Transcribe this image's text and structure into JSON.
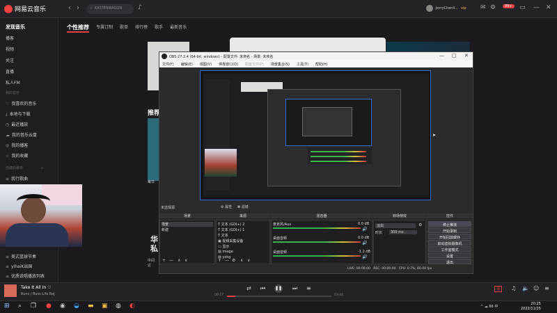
{
  "app": {
    "name": "网易云音乐"
  },
  "topbar": {
    "search_placeholder": "KASTENWAGON",
    "username": "JerryChenli...",
    "level": "vip",
    "badge": "99+"
  },
  "sidebar": {
    "items": [
      {
        "label": "发现音乐",
        "active": true
      },
      {
        "label": "播客"
      },
      {
        "label": "视频"
      },
      {
        "label": "关注"
      },
      {
        "label": "直播"
      },
      {
        "label": "私人FM"
      }
    ],
    "my_music_label": "我的音乐",
    "my_items": [
      "我喜欢的音乐",
      "本地与下载",
      "最近播放",
      "我的音乐云盘",
      "我的播客",
      "我的收藏"
    ],
    "created_label": "创建的歌单",
    "playlists": [
      "我行歌曲",
      "美式篮球节奏",
      "yihaiK出国",
      "优质说唱播放列表"
    ]
  },
  "tabs": [
    "个性推荐",
    "专属订制",
    "歌单",
    "排行榜",
    "歌手",
    "最新音乐"
  ],
  "main": {
    "recommend_title": "推荐",
    "daily_label": "每日",
    "big_text": "华\n私",
    "small_text": "中间\n达"
  },
  "obs": {
    "title": "OBS 27.2.4 (64-bit, windows) - 配置文件: 未命名 - 场景: 未命名",
    "menu": [
      "文件(F)",
      "编辑(E)",
      "视图(V)",
      "停靠窗口(D)",
      "配置文件(P)",
      "场景集合(S)",
      "工具(T)",
      "帮助(H)"
    ],
    "no_source": "未选择源",
    "prop_btn": "属性",
    "filter_btn": "滤镜",
    "docks": {
      "scenes": {
        "title": "场景",
        "items": [
          "场景",
          "新建"
        ]
      },
      "sources": {
        "title": "来源",
        "items": [
          "文本 (GDI+) 2",
          "文本 (GDI+) 1",
          "文本",
          "视频采集设备",
          "显示",
          "image",
          "yxkg"
        ]
      },
      "mixer": {
        "title": "混音器",
        "channels": [
          {
            "name": "麦克风/Aux",
            "db": "0.0 dB"
          },
          {
            "name": "桌面音频",
            "db": "0.0 dB"
          },
          {
            "name": "桌面音频",
            "db": "-1.2 dB"
          }
        ]
      },
      "transitions": {
        "title": "转场特效",
        "type": "淡出",
        "duration_label": "时长",
        "duration": "300 ms"
      },
      "controls": {
        "title": "控件",
        "buttons": [
          "停止推流",
          "开始录制",
          "开始回放缓存",
          "启动虚拟摄像机",
          "工作室模式",
          "设置",
          "退出"
        ]
      }
    },
    "status": "LIVE: 00:00:00   REC: 00:00:00   CPU: 0.7%, 60.00 fps"
  },
  "player": {
    "song": "Take It All In",
    "artist": "Runs / Russ Life Raj",
    "current": "00:17",
    "duration": "03:44",
    "progress": 0.08,
    "lyric_btn": "词"
  },
  "taskbar": {
    "time": "20:25",
    "date": "2022/11/25",
    "lang": "中",
    "battle": "66"
  },
  "colors": {
    "accent": "#ec4141",
    "obs_select": "#3a6ad0"
  }
}
